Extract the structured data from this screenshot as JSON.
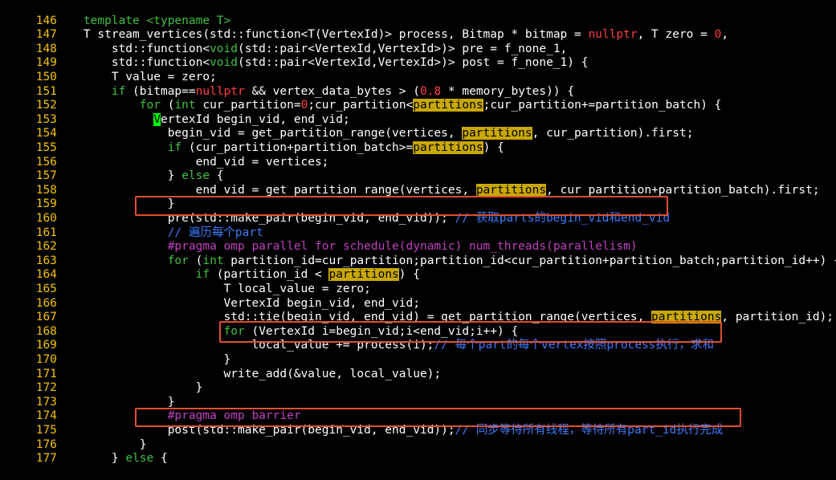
{
  "line_numbers": [
    "146",
    "147",
    "148",
    "149",
    "150",
    "151",
    "152",
    "153",
    "154",
    "155",
    "156",
    "157",
    "158",
    "159",
    "160",
    "161",
    "162",
    "163",
    "164",
    "165",
    "166",
    "167",
    "168",
    "169",
    "170",
    "171",
    "172",
    "173",
    "174",
    "175",
    "176",
    "177"
  ],
  "code": {
    "l146": {
      "indent": "    ",
      "a": "template <",
      "b": "typename",
      "c": " T>"
    },
    "l147": {
      "a": "T stream_vertices(std::function<T(VertexId)> process, Bitmap * bitmap = ",
      "b": "nullptr",
      "c": ", T zero = ",
      "d": "0",
      "e": ","
    },
    "l148": {
      "a": "std::function<",
      "b": "void",
      "c": "(std::pair<VertexId,VertexId>)> pre = f_none_1,"
    },
    "l149": {
      "a": "std::function<",
      "b": "void",
      "c": "(std::pair<VertexId,VertexId>)> post = f_none_1) {"
    },
    "l150": {
      "a": "T value = zero;"
    },
    "l151": {
      "a": "if",
      "b": " (bitmap==",
      "c": "nullptr",
      "d": " && vertex_data_bytes > (",
      "e": "0.8",
      "f": " * memory_bytes)) {"
    },
    "l152": {
      "a": "for",
      "b": " (",
      "c": "int",
      "d": " cur_partition=",
      "e": "0",
      "f": ";cur_partition<",
      "g": "partitions",
      "h": ";cur_partition+=partition_batch) {"
    },
    "l153": {
      "a": "V",
      "b": "ertexId begin_vid, end_vid;"
    },
    "l154": {
      "a": "begin_vid = get_partition_range(vertices, ",
      "b": "partitions",
      "c": ", cur_partition).first;"
    },
    "l155": {
      "a": "if",
      "b": " (cur_partition+partition_batch>=",
      "c": "partitions",
      "d": ") {"
    },
    "l156": {
      "a": "end_vid = vertices;"
    },
    "l157": {
      "a": "} ",
      "b": "else",
      "c": " {"
    },
    "l158": {
      "a": "end_vid = get_partition_range(vertices, ",
      "b": "partitions",
      "c": ", cur_partition+partition_batch).first;"
    },
    "l159": {
      "a": "}"
    },
    "l160": {
      "a": "pre(std::make_pair(begin_vid, end_vid)); ",
      "b": "// 获取parts的begin_vid和end_vid"
    },
    "l161": {
      "a": "// 遍历每个part"
    },
    "l162": {
      "a": "#pragma omp parallel for schedule(dynamic) num_threads(parallelism)"
    },
    "l163": {
      "a": "for",
      "b": " (",
      "c": "int",
      "d": " partition_id=cur_partition;partition_id<cur_partition+partition_batch;partition_id++) {"
    },
    "l164": {
      "a": "if",
      "b": " (partition_id < ",
      "c": "partitions",
      "d": ") {"
    },
    "l165": {
      "a": "T local_value = zero;"
    },
    "l166": {
      "a": "VertexId begin_vid, end_vid;"
    },
    "l167": {
      "a": "std::tie(begin_vid, end_vid) = get_partition_range(vertices, ",
      "b": "partitions",
      "c": ", partition_id);"
    },
    "l168": {
      "a": "for",
      "b": " (VertexId i=begin_vid;i<end_vid;i++) {"
    },
    "l169": {
      "a": "local_value += process(i);",
      "b": "// 每个part的每个vertex按照process执行，求和"
    },
    "l170": {
      "a": "}"
    },
    "l171": {
      "a": "write_add(&value, local_value);"
    },
    "l172": {
      "a": "}"
    },
    "l173": {
      "a": "}"
    },
    "l174": {
      "a": "#pragma omp barrier"
    },
    "l175": {
      "a": "post(std::make_pair(begin_vid, end_vid));",
      "b": "// 同步等待所有线程，等待所有part_id执行完成"
    },
    "l176": {
      "a": "}"
    },
    "l177": {
      "a": "} ",
      "b": "else",
      "c": " {"
    }
  },
  "colors": {
    "line_number": "#f2c200",
    "keyword": "#40c040",
    "number": "#ff4040",
    "comment": "#3d7cff",
    "preprocessor": "#c040c0",
    "search_highlight": "#c8a800",
    "cursor": "#00ff00",
    "annotation_box": "#e0502e"
  }
}
